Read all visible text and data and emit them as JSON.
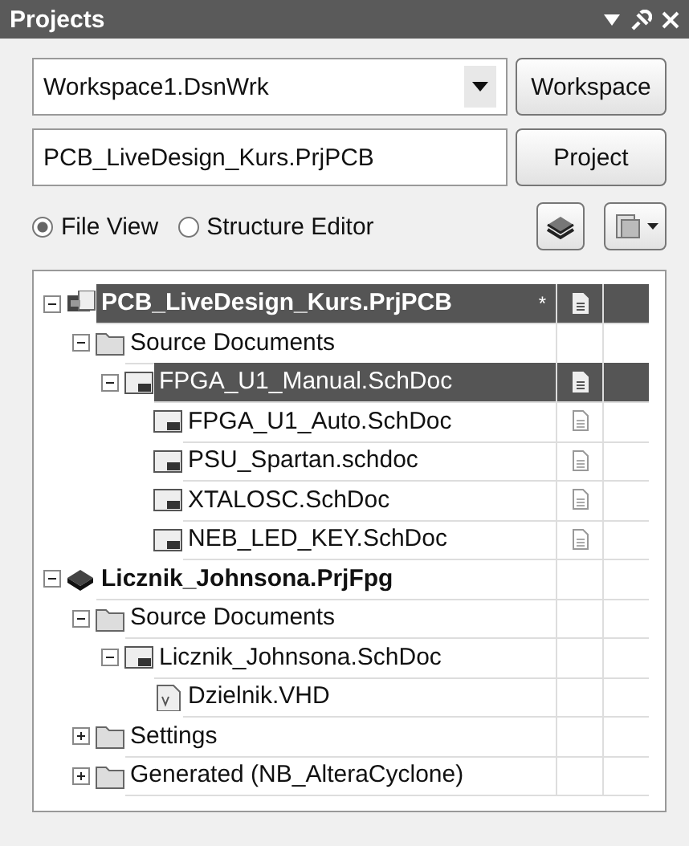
{
  "panel": {
    "title": "Projects"
  },
  "workspace": {
    "value": "Workspace1.DsnWrk",
    "button": "Workspace"
  },
  "project": {
    "value": "PCB_LiveDesign_Kurs.PrjPCB",
    "button": "Project"
  },
  "views": [
    {
      "label": "File View",
      "selected": true
    },
    {
      "label": "Structure Editor",
      "selected": false
    }
  ],
  "tree": [
    {
      "kind": "project",
      "label": "PCB_LiveDesign_Kurs.PrjPCB",
      "modified": "*",
      "selected": true,
      "expanded": true,
      "doc_icon": true,
      "children": [
        {
          "kind": "folder",
          "label": "Source Documents",
          "selected": false,
          "expanded": true,
          "doc_icon": false,
          "children": [
            {
              "kind": "schdoc",
              "label": "FPGA_U1_Manual.SchDoc",
              "selected": true,
              "expanded": true,
              "doc_icon": true,
              "children": [
                {
                  "kind": "schdoc",
                  "label": "FPGA_U1_Auto.SchDoc",
                  "selected": false,
                  "doc_icon": true
                },
                {
                  "kind": "schdoc",
                  "label": "PSU_Spartan.schdoc",
                  "selected": false,
                  "doc_icon": true
                },
                {
                  "kind": "schdoc",
                  "label": "XTALOSC.SchDoc",
                  "selected": false,
                  "doc_icon": true
                },
                {
                  "kind": "schdoc",
                  "label": "NEB_LED_KEY.SchDoc",
                  "selected": false,
                  "doc_icon": true
                }
              ]
            }
          ]
        }
      ]
    },
    {
      "kind": "fpga",
      "label": "Licznik_Johnsona.PrjFpg",
      "selected": false,
      "expanded": true,
      "doc_icon": false,
      "children": [
        {
          "kind": "folder",
          "label": "Source Documents",
          "selected": false,
          "expanded": true,
          "doc_icon": false,
          "children": [
            {
              "kind": "schdoc",
              "label": "Licznik_Johnsona.SchDoc",
              "selected": false,
              "expanded": true,
              "doc_icon": false,
              "children": [
                {
                  "kind": "vhd",
                  "label": "Dzielnik.VHD",
                  "selected": false,
                  "doc_icon": false
                }
              ]
            }
          ]
        },
        {
          "kind": "folder",
          "label": "Settings",
          "selected": false,
          "expanded": false,
          "doc_icon": false
        },
        {
          "kind": "folder",
          "label": "Generated (NB_AlteraCyclone)",
          "selected": false,
          "expanded": false,
          "doc_icon": false
        }
      ]
    }
  ]
}
